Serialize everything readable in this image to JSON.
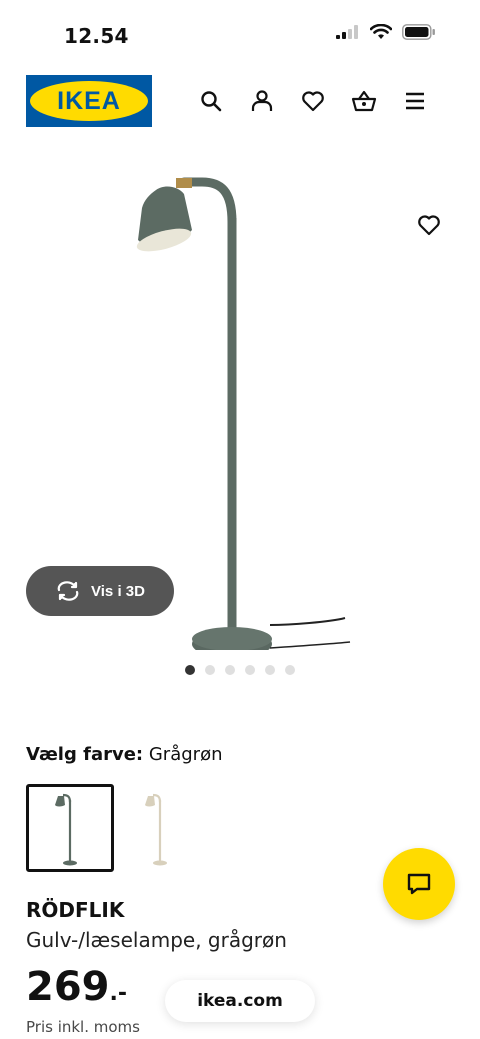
{
  "status": {
    "time": "12.54",
    "icons": [
      "signal-icon",
      "wifi-icon",
      "battery-icon"
    ]
  },
  "header": {
    "logo_text": "IKEA",
    "brand_colors": {
      "blue": "#0058a3",
      "yellow": "#ffdb00"
    },
    "icons": [
      "search-icon",
      "account-icon",
      "wishlist-icon",
      "basket-icon",
      "menu-icon"
    ]
  },
  "gallery": {
    "view3d_label": "Vis i 3D",
    "image_count": 6,
    "active_index": 0
  },
  "color": {
    "label": "Vælg farve:",
    "value": "Grågrøn",
    "swatches": [
      {
        "name": "Grågrøn",
        "color": "#5c6b63",
        "selected": true
      },
      {
        "name": "beige",
        "color": "#d8d0bc",
        "selected": false
      }
    ]
  },
  "product": {
    "name": "RÖDFLIK",
    "description": "Gulv-/læselampe, grågrøn",
    "price": "269",
    "price_suffix": ".-",
    "price_note": "Pris inkl. moms"
  },
  "footer": {
    "url": "ikea.com"
  }
}
